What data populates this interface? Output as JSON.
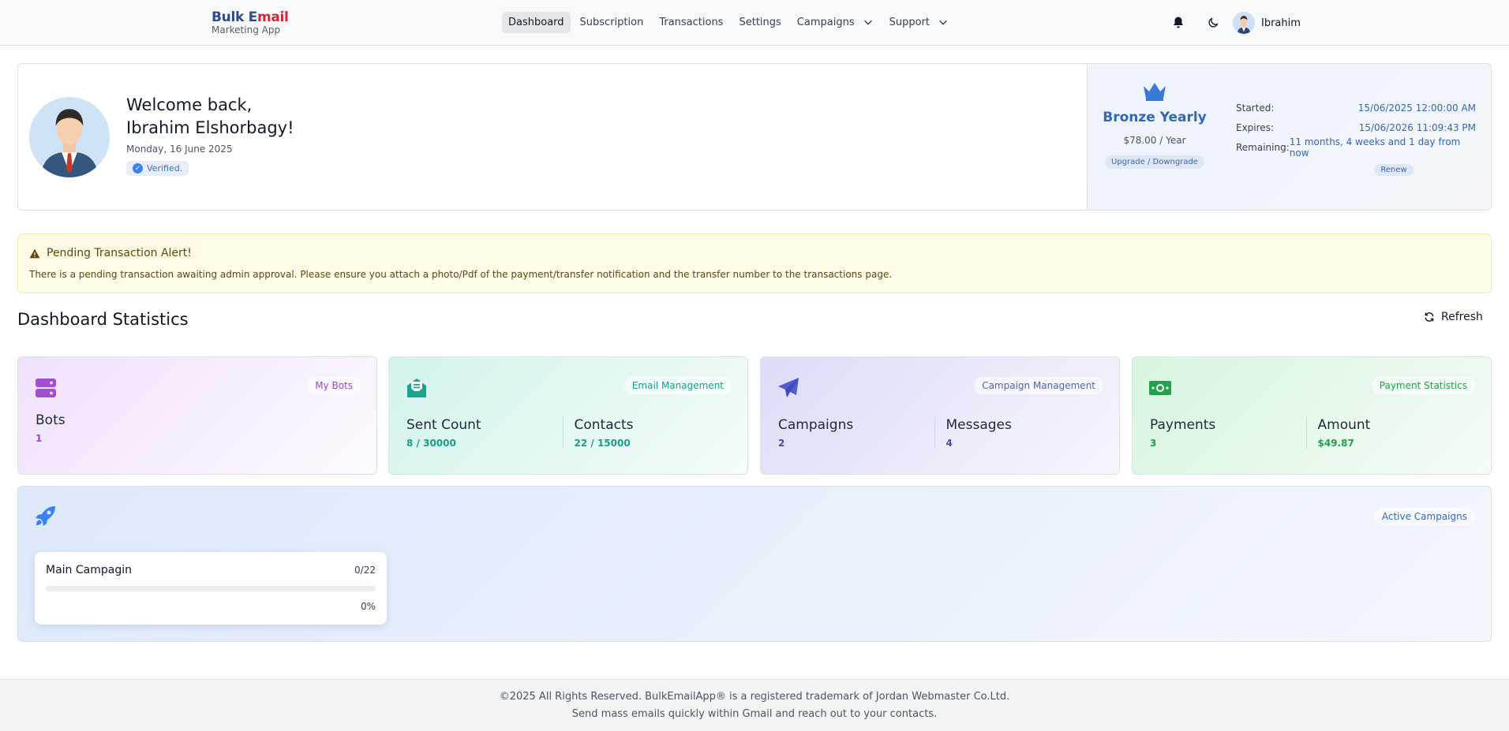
{
  "nav": {
    "brand_line1_a": "Bulk E",
    "brand_line1_b": "mail",
    "brand_line2": "Marketing App",
    "links": [
      "Dashboard",
      "Subscription",
      "Transactions",
      "Settings",
      "Campaigns",
      "Support"
    ],
    "user_name": "Ibrahim"
  },
  "welcome": {
    "line1": "Welcome back,",
    "line2": "Ibrahim Elshorbagy!",
    "date": "Monday, 16 June 2025",
    "verified": "Verified."
  },
  "plan": {
    "name": "Bronze Yearly",
    "price": "$78.00 / Year",
    "upgrade_label": "Upgrade / Downgrade",
    "started_label": "Started:",
    "started_value": "15/06/2025 12:00:00 AM",
    "expires_label": "Expires:",
    "expires_value": "15/06/2026 11:09:43 PM",
    "remaining_label": "Remaining:",
    "remaining_value": "11 months, 4 weeks and 1 day from now",
    "renew_label": "Renew"
  },
  "alert": {
    "title": "Pending Transaction Alert!",
    "body": "There is a pending transaction awaiting admin approval. Please ensure you attach a photo/Pdf of the payment/transfer notification and the transfer number to the transactions page."
  },
  "stats": {
    "title": "Dashboard Statistics",
    "refresh_label": "Refresh",
    "bots": {
      "chip": "My Bots",
      "label": "Bots",
      "value": "1"
    },
    "email": {
      "chip": "Email Management",
      "sent_label": "Sent Count",
      "sent_value": "8 / 30000",
      "contacts_label": "Contacts",
      "contacts_value": "22 / 15000"
    },
    "campaign": {
      "chip": "Campaign Management",
      "campaigns_label": "Campaigns",
      "campaigns_value": "2",
      "messages_label": "Messages",
      "messages_value": "4"
    },
    "payment": {
      "chip": "Payment Statistics",
      "payments_label": "Payments",
      "payments_value": "3",
      "amount_label": "Amount",
      "amount_value": "$49.87"
    }
  },
  "active_campaigns": {
    "chip": "Active Campaigns",
    "items": [
      {
        "name": "Main Campagin",
        "count": "0/22",
        "percent": "0%",
        "progress": 0
      }
    ]
  },
  "footer": {
    "line1": "©2025 All Rights Reserved. BulkEmailApp® is a registered trademark of Jordan Webmaster Co.Ltd.",
    "line2": "Send mass emails quickly within Gmail and reach out to your contacts."
  },
  "colors": {
    "brand_blue": "#2f4a8c",
    "brand_red": "#d4243a",
    "plan_blue": "#3368b5",
    "bots_purple": "#9b47c8",
    "email_teal": "#16a08a",
    "campaign_indigo": "#4f46b8",
    "payment_green": "#1ea14a"
  },
  "icons": [
    "bell-icon",
    "moon-icon",
    "crown-icon",
    "warning-icon",
    "refresh-icon",
    "server-icon",
    "envelope-open-icon",
    "paper-plane-icon",
    "money-icon",
    "rocket-icon",
    "chevron-down-icon",
    "check-circle-icon"
  ]
}
